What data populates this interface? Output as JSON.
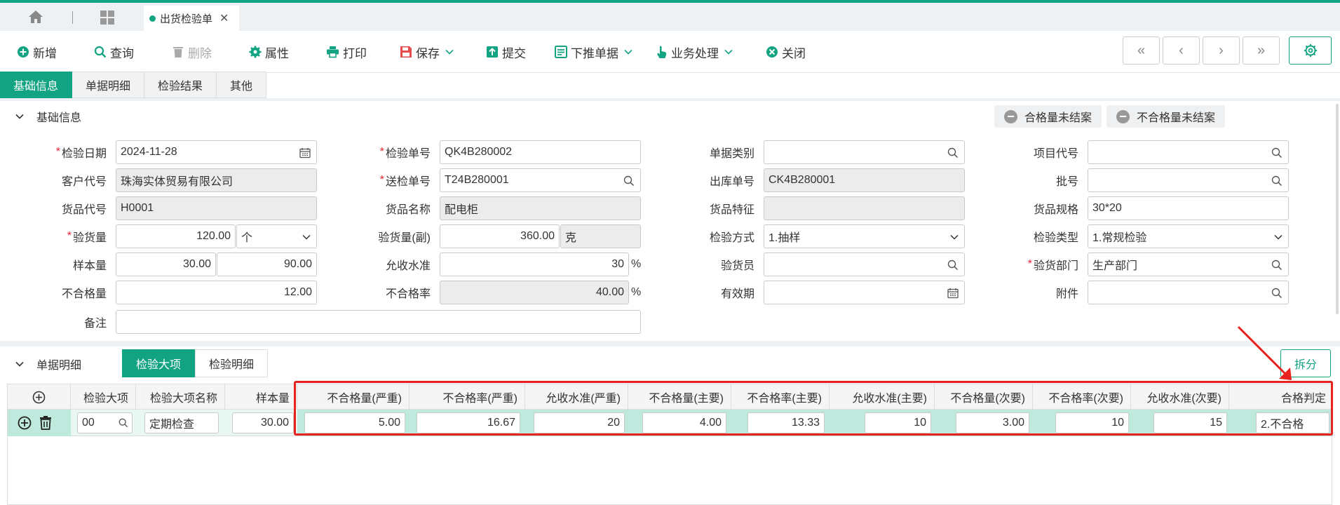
{
  "tabbar": {
    "tab_title": "出货检验单"
  },
  "toolbar": {
    "new": "新增",
    "query": "查询",
    "delete": "删除",
    "props": "属性",
    "print": "打印",
    "save": "保存",
    "submit": "提交",
    "push": "下推单据",
    "biz": "业务处理",
    "close": "关闭"
  },
  "subtabs": [
    "基础信息",
    "单据明细",
    "检验结果",
    "其他"
  ],
  "basic": {
    "section_title": "基础信息",
    "tag_pass": "合格量未结案",
    "tag_fail": "不合格量未结案"
  },
  "form": {
    "insp_date_label": "检验日期",
    "insp_date": "2024-11-28",
    "insp_no_label": "检验单号",
    "insp_no": "QK4B280002",
    "doc_type_label": "单据类别",
    "doc_type": "",
    "proj_label": "项目代号",
    "proj": "",
    "cust_label": "客户代号",
    "cust": "珠海实体贸易有限公司",
    "send_no_label": "送检单号",
    "send_no": "T24B280001",
    "out_no_label": "出库单号",
    "out_no": "CK4B280001",
    "batch_label": "批号",
    "batch": "",
    "item_code_label": "货品代号",
    "item_code": "H0001",
    "item_name_label": "货品名称",
    "item_name": "配电柜",
    "item_feat_label": "货品特征",
    "item_feat": "",
    "item_spec_label": "货品规格",
    "item_spec": "30*20",
    "qty_label": "验货量",
    "qty": "120.00",
    "qty_unit": "个",
    "qty2_label": "验货量(副)",
    "qty2": "360.00",
    "qty2_unit": "克",
    "method_label": "检验方式",
    "method": "1.抽样",
    "type_label": "检验类型",
    "type": "1.常规检验",
    "sample_label": "样本量",
    "sample1": "30.00",
    "sample2": "90.00",
    "accept_label": "允收水准",
    "accept": "30",
    "pct": "%",
    "inspector_label": "验货员",
    "inspector": "",
    "dept_label": "验货部门",
    "dept": "生产部门",
    "bad_qty_label": "不合格量",
    "bad_qty": "12.00",
    "bad_rate_label": "不合格率",
    "bad_rate": "40.00",
    "valid_label": "有效期",
    "valid": "",
    "attach_label": "附件",
    "attach": "",
    "remark_label": "备注",
    "remark": ""
  },
  "detail": {
    "section_title": "单据明细",
    "tabs": [
      "检验大项",
      "检验明细"
    ],
    "split": "拆分",
    "headers": [
      "检验大项",
      "检验大项名称",
      "样本量",
      "不合格量(严重)",
      "不合格率(严重)",
      "允收水准(严重)",
      "不合格量(主要)",
      "不合格率(主要)",
      "允收水准(主要)",
      "不合格量(次要)",
      "不合格率(次要)",
      "允收水准(次要)",
      "合格判定"
    ],
    "row": [
      "00",
      "定期检查",
      "30.00",
      "5.00",
      "16.67",
      "20",
      "4.00",
      "13.33",
      "10",
      "3.00",
      "10",
      "15",
      "2.不合格"
    ]
  },
  "colors": {
    "accent": "#12a383",
    "annotation": "#e8231f"
  }
}
